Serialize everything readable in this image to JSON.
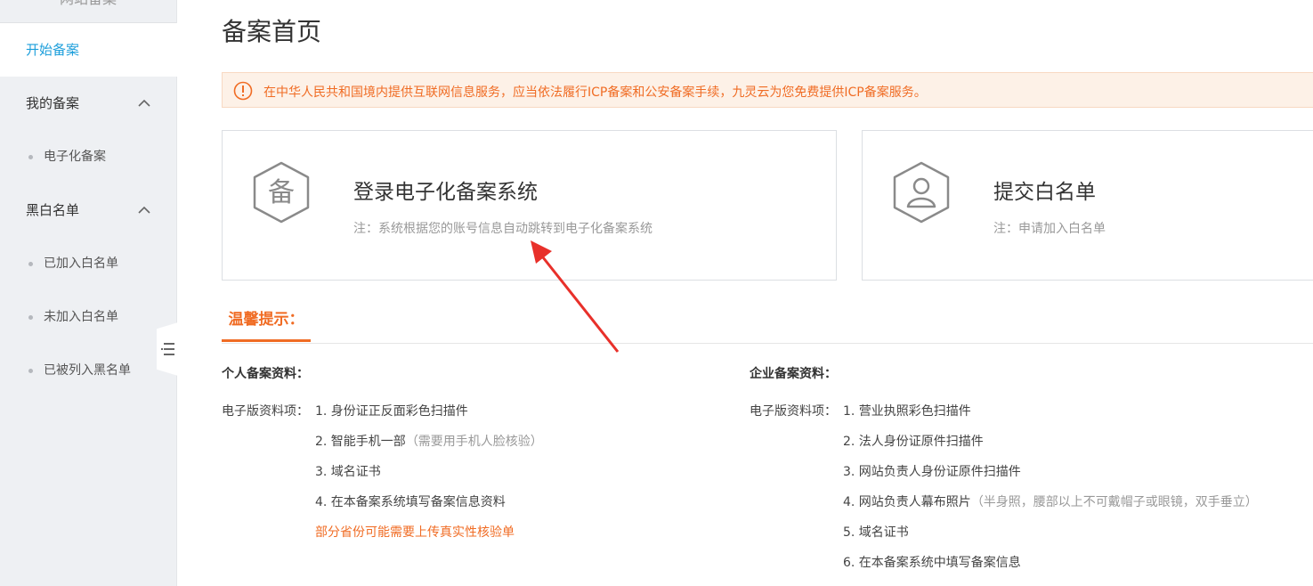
{
  "sidebar": {
    "heading": "网站备案",
    "start_label": "开始备案",
    "groups": [
      {
        "label": "我的备案",
        "items": [
          "电子化备案"
        ]
      },
      {
        "label": "黑白名单",
        "items": [
          "已加入白名单",
          "未加入白名单",
          "已被列入黑名单"
        ]
      }
    ],
    "collapse_icon": "menu-collapse-icon"
  },
  "page_title": "备案首页",
  "notice": {
    "icon": "warning-circle-icon",
    "text": "在中华人民共和国境内提供互联网信息服务，应当依法履行ICP备案和公安备案手续，九灵云为您免费提供ICP备案服务。"
  },
  "cards": [
    {
      "icon": "bei-hexagon-icon",
      "icon_char": "备",
      "title": "登录电子化备案系统",
      "note": "注：系统根据您的账号信息自动跳转到电子化备案系统"
    },
    {
      "icon": "user-hexagon-icon",
      "title": "提交白名单",
      "note": "注：申请加入白名单"
    }
  ],
  "tab": {
    "label": "温馨提示："
  },
  "personal": {
    "title": "个人备案资料：",
    "row_label": "电子版资料项：",
    "items": [
      {
        "text": "1. 身份证正反面彩色扫描件",
        "hint": ""
      },
      {
        "text": "2. 智能手机一部",
        "hint": "（需要用手机人脸核验）"
      },
      {
        "text": "3. 域名证书",
        "hint": ""
      },
      {
        "text": "4. 在本备案系统填写备案信息资料",
        "hint": ""
      }
    ],
    "warning": "部分省份可能需要上传真实性核验单"
  },
  "enterprise": {
    "title": "企业备案资料：",
    "row_label": "电子版资料项：",
    "items": [
      {
        "text": "1. 营业执照彩色扫描件",
        "hint": ""
      },
      {
        "text": "2. 法人身份证原件扫描件",
        "hint": ""
      },
      {
        "text": "3. 网站负责人身份证原件扫描件",
        "hint": ""
      },
      {
        "text": "4. 网站负责人幕布照片",
        "hint": "（半身照，腰部以上不可戴帽子或眼镜，双手垂立）"
      },
      {
        "text": "5. 域名证书",
        "hint": ""
      },
      {
        "text": "6. 在本备案系统中填写备案信息",
        "hint": ""
      }
    ]
  },
  "colors": {
    "accent": "#f06c24",
    "link": "#1e9fdb",
    "sidebar_bg": "#eef0f3",
    "notice_bg": "#fdf1e7",
    "arrow": "#e8302a"
  }
}
